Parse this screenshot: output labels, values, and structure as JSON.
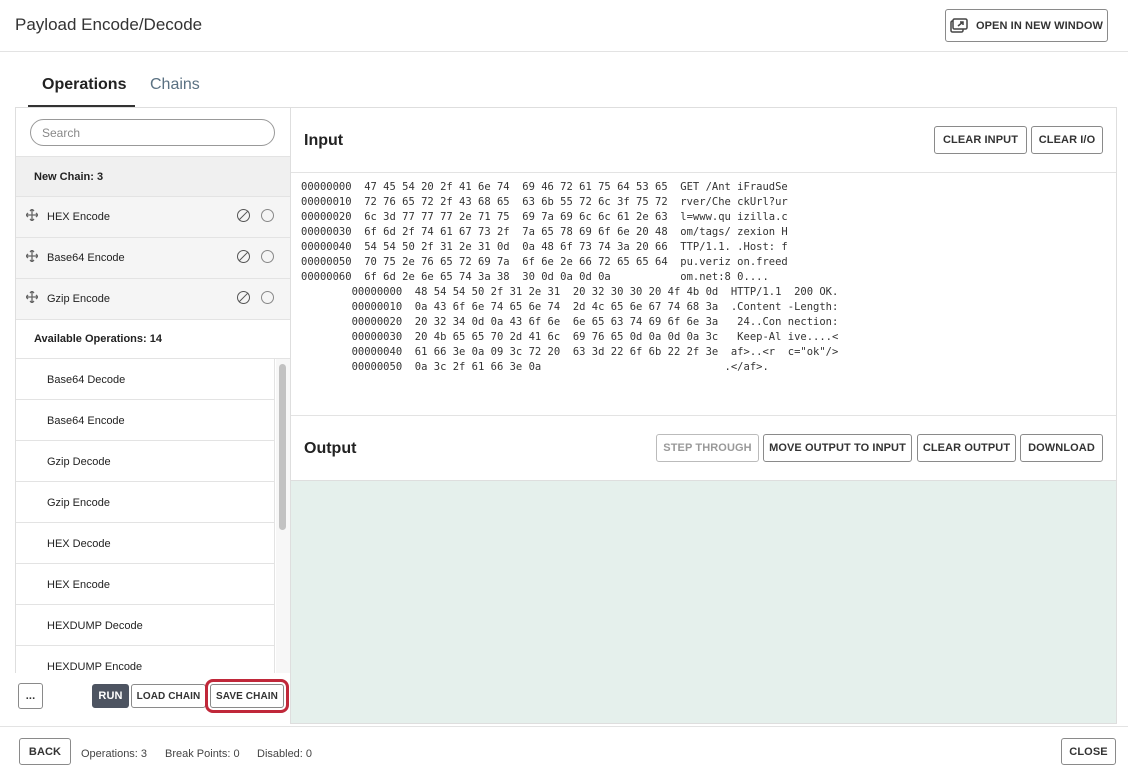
{
  "dialog": {
    "title": "Payload Encode/Decode",
    "open_new_window_label": "OPEN IN NEW WINDOW"
  },
  "tabs": [
    {
      "label": "Operations",
      "active": true
    },
    {
      "label": "Chains",
      "active": false
    }
  ],
  "search": {
    "placeholder": "Search",
    "value": ""
  },
  "chain": {
    "header": "New Chain: 3",
    "items": [
      {
        "label": "HEX Encode"
      },
      {
        "label": "Base64 Encode"
      },
      {
        "label": "Gzip Encode"
      }
    ]
  },
  "available": {
    "header": "Available Operations: 14",
    "items": [
      {
        "label": "Base64 Decode"
      },
      {
        "label": "Base64 Encode"
      },
      {
        "label": "Gzip Decode"
      },
      {
        "label": "Gzip Encode"
      },
      {
        "label": "HEX Decode"
      },
      {
        "label": "HEX Encode"
      },
      {
        "label": "HEXDUMP Decode"
      },
      {
        "label": "HEXDUMP Encode"
      }
    ]
  },
  "left_footer": {
    "more_label": "...",
    "run_label": "RUN",
    "load_chain_label": "LOAD CHAIN",
    "save_chain_label": "SAVE CHAIN"
  },
  "input": {
    "title": "Input",
    "clear_input_label": "CLEAR INPUT",
    "clear_io_label": "CLEAR I/O",
    "content": "00000000  47 45 54 20 2f 41 6e 74  69 46 72 61 75 64 53 65  GET /Ant iFraudSe\n00000010  72 76 65 72 2f 43 68 65  63 6b 55 72 6c 3f 75 72  rver/Che ckUrl?ur\n00000020  6c 3d 77 77 77 2e 71 75  69 7a 69 6c 6c 61 2e 63  l=www.qu izilla.c\n00000030  6f 6d 2f 74 61 67 73 2f  7a 65 78 69 6f 6e 20 48  om/tags/ zexion H\n00000040  54 54 50 2f 31 2e 31 0d  0a 48 6f 73 74 3a 20 66  TTP/1.1. .Host: f\n00000050  70 75 2e 76 65 72 69 7a  6f 6e 2e 66 72 65 65 64  pu.veriz on.freed\n00000060  6f 6d 2e 6e 65 74 3a 38  30 0d 0a 0d 0a           om.net:8 0....\n        00000000  48 54 54 50 2f 31 2e 31  20 32 30 30 20 4f 4b 0d  HTTP/1.1  200 OK.\n        00000010  0a 43 6f 6e 74 65 6e 74  2d 4c 65 6e 67 74 68 3a  .Content -Length:\n        00000020  20 32 34 0d 0a 43 6f 6e  6e 65 63 74 69 6f 6e 3a   24..Con nection:\n        00000030  20 4b 65 65 70 2d 41 6c  69 76 65 0d 0a 0d 0a 3c   Keep-Al ive....<\n        00000040  61 66 3e 0a 09 3c 72 20  63 3d 22 6f 6b 22 2f 3e  af>..<r  c=\"ok\"/>\n        00000050  0a 3c 2f 61 66 3e 0a                             .</af>."
  },
  "output": {
    "title": "Output",
    "step_through_label": "STEP THROUGH",
    "move_output_label": "MOVE OUTPUT TO INPUT",
    "clear_output_label": "CLEAR OUTPUT",
    "download_label": "DOWNLOAD",
    "content": ""
  },
  "bottom": {
    "back_label": "BACK",
    "operations_stat": "Operations: 3",
    "break_points_stat": "Break Points: 0",
    "disabled_stat": "Disabled: 0",
    "close_label": "CLOSE"
  },
  "colors": {
    "output_bg": "#e5f0ec",
    "highlight": "#c0283a",
    "run_button": "#4d5461",
    "chains_tab": "#5a7182"
  }
}
